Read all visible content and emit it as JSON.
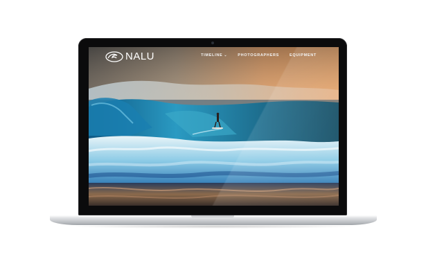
{
  "site": {
    "logo_text": "NALU",
    "logo_icon": "wave-logo-icon",
    "nav": [
      {
        "label": "TIMELINE",
        "has_dropdown": true
      },
      {
        "label": "PHOTOGRAPHERS",
        "has_dropdown": false
      },
      {
        "label": "EQUIPMENT",
        "has_dropdown": false
      }
    ],
    "hero_image": "surfer-riding-barrel-wave-at-sunset"
  },
  "device": {
    "type": "laptop"
  },
  "colors": {
    "bezel": "#0b0b0c",
    "nav_text": "#f3f3f3",
    "wave_blue": "#1f7fb4",
    "sky_orange": "#f0a463"
  }
}
